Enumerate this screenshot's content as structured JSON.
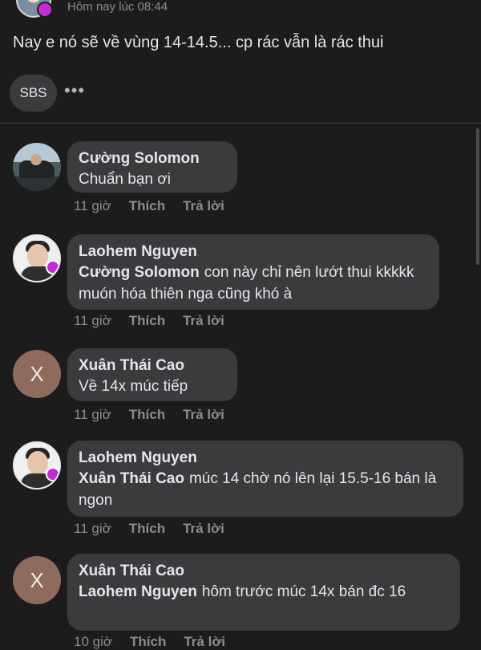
{
  "post": {
    "time": "Hôm nay lúc 08:44",
    "text": "Nay e nó sẽ về vùng 14-14.5... cp rác vẫn là rác thui",
    "tag_label": "SBS",
    "more_label": "•••"
  },
  "comments": [
    {
      "author": "Cường Solomon",
      "mention": "",
      "text": "Chuẩn bạn ơi",
      "time": "11 giờ",
      "like_label": "Thích",
      "reply_label": "Trả lời"
    },
    {
      "author": "Laohem Nguyen",
      "mention": "Cường Solomon",
      "text": "con này chỉ nên lướt thui kkkkk muón hóa thiên nga cũng khó à",
      "time": "11 giờ",
      "like_label": "Thích",
      "reply_label": "Trả lời"
    },
    {
      "author": "Xuân Thái Cao",
      "avatar_letter": "X",
      "mention": "",
      "text": "Về 14x múc tiếp",
      "time": "11 giờ",
      "like_label": "Thích",
      "reply_label": "Trả lời"
    },
    {
      "author": "Laohem Nguyen",
      "mention": "Xuân Thái Cao",
      "text": "múc 14 chờ nó lên lại 15.5-16 bán là ngon",
      "time": "11 giờ",
      "like_label": "Thích",
      "reply_label": "Trả lời"
    },
    {
      "author": "Xuân Thái Cao",
      "avatar_letter": "X",
      "mention": "Laohem Nguyen",
      "text": "hôm trước múc 14x bán đc 16",
      "time": "10 giờ",
      "like_label": "Thích",
      "reply_label": "Trả lời"
    }
  ]
}
